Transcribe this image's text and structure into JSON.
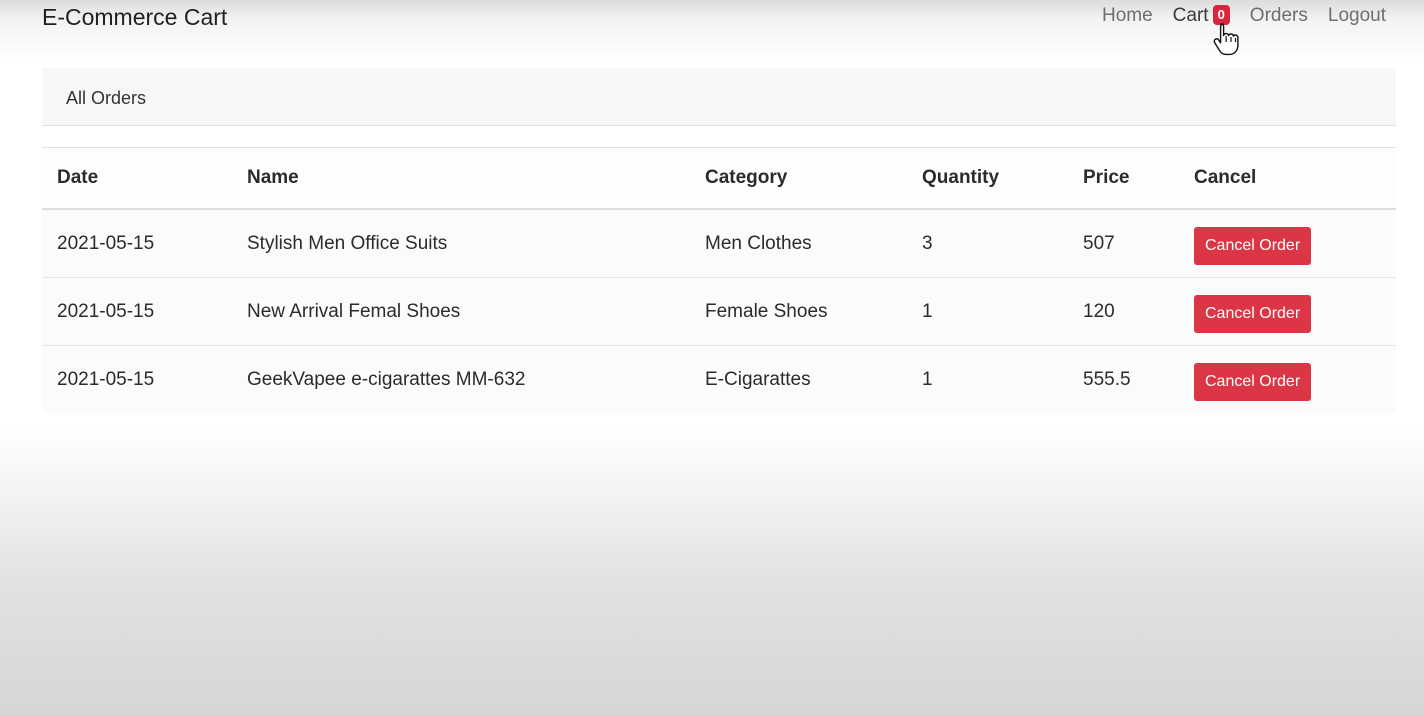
{
  "navbar": {
    "brand": "E-Commerce Cart",
    "links": {
      "home": "Home",
      "cart": "Cart",
      "cart_count": "0",
      "orders": "Orders",
      "logout": "Logout"
    }
  },
  "card": {
    "title": "All Orders"
  },
  "table": {
    "headers": {
      "date": "Date",
      "name": "Name",
      "category": "Category",
      "quantity": "Quantity",
      "price": "Price",
      "cancel": "Cancel"
    },
    "rows": [
      {
        "date": "2021-05-15",
        "name": "Stylish Men Office Suits",
        "category": "Men Clothes",
        "quantity": "3",
        "price": "507",
        "action": "Cancel Order"
      },
      {
        "date": "2021-05-15",
        "name": "New Arrival Femal Shoes",
        "category": "Female Shoes",
        "quantity": "1",
        "price": "120",
        "action": "Cancel Order"
      },
      {
        "date": "2021-05-15",
        "name": "GeekVapee e-cigarattes MM-632",
        "category": "E-Cigarattes",
        "quantity": "1",
        "price": "555.5",
        "action": "Cancel Order"
      }
    ]
  },
  "colors": {
    "danger": "#dc3545",
    "badge": "#d7263d"
  },
  "icons": {
    "cursor": "hand-pointer-cursor-icon"
  }
}
